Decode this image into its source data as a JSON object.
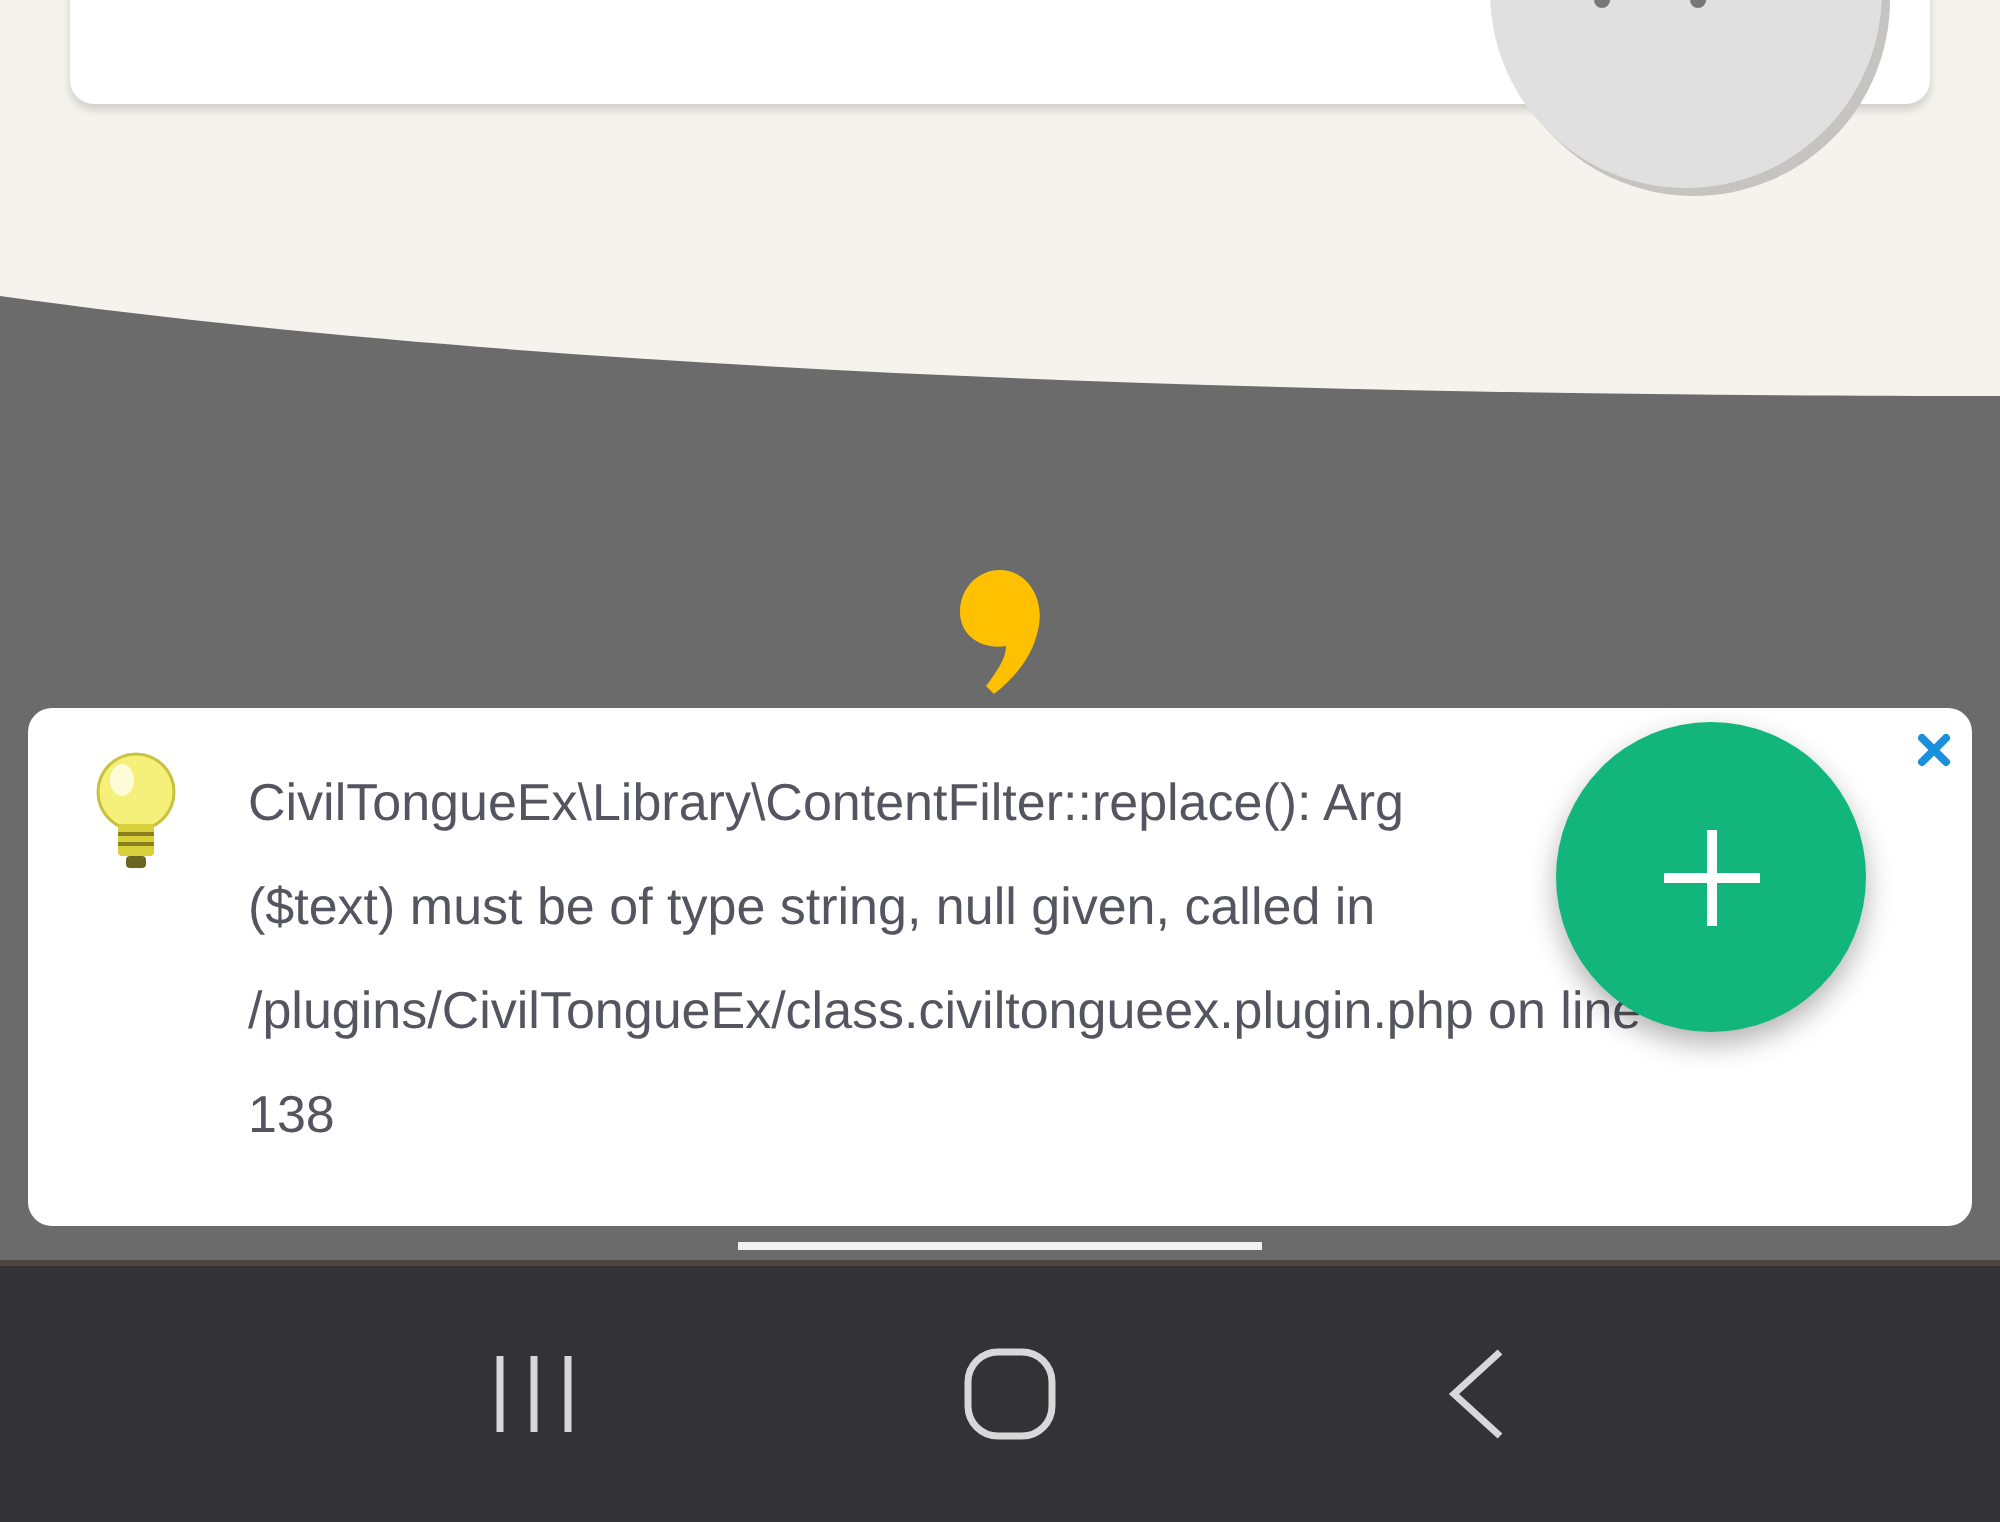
{
  "notice": {
    "message_lines": [
      "CivilTongueEx\\Library\\ContentFilter::replace(): Arg",
      "($text) must be of type string, null given, called in",
      "/plugins/CivilTongueEx/class.civiltongueex.plugin.php on line",
      "138"
    ]
  }
}
